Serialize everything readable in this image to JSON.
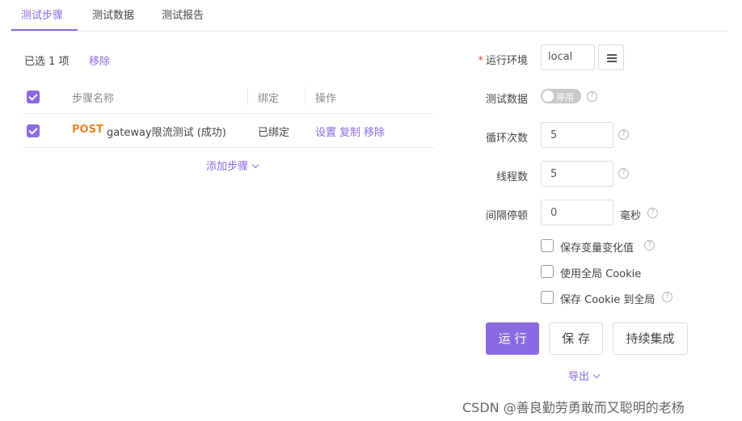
{
  "tabs": [
    {
      "label": "测试步骤",
      "active": true
    },
    {
      "label": "测试数据",
      "active": false
    },
    {
      "label": "测试报告",
      "active": false
    }
  ],
  "selection": {
    "text": "已选 1 项",
    "remove_label": "移除"
  },
  "table": {
    "headers": [
      "步骤名称",
      "绑定",
      "操作"
    ],
    "rows": [
      {
        "checked": true,
        "method": "POST",
        "name": "gateway限流测试 (成功)",
        "bound": "已绑定",
        "actions": [
          "设置",
          "复制",
          "移除"
        ]
      }
    ],
    "add_step_label": "添加步骤"
  },
  "form": {
    "env": {
      "label": "运行环境",
      "required": true,
      "value": "local"
    },
    "test_data": {
      "label": "测试数据",
      "toggle_text": "停用",
      "enabled": false
    },
    "loops": {
      "label": "循环次数",
      "value": "5"
    },
    "threads": {
      "label": "线程数",
      "value": "5"
    },
    "interval": {
      "label": "间隔停顿",
      "value": "0",
      "unit": "毫秒"
    },
    "options": [
      {
        "label": "保存变量变化值",
        "checked": false,
        "help": true
      },
      {
        "label": "使用全局 Cookie",
        "checked": false,
        "help": false
      },
      {
        "label": "保存 Cookie 到全局",
        "checked": false,
        "help": true
      }
    ]
  },
  "buttons": {
    "run": "运 行",
    "save": "保 存",
    "ci": "持续集成"
  },
  "export_label": "导出",
  "help_glyph": "?",
  "watermark": "CSDN @善良勤劳勇敢而又聪明的老杨",
  "colors": {
    "accent": "#8a6ae0",
    "method_post": "#e8832a",
    "required": "#e54545"
  }
}
